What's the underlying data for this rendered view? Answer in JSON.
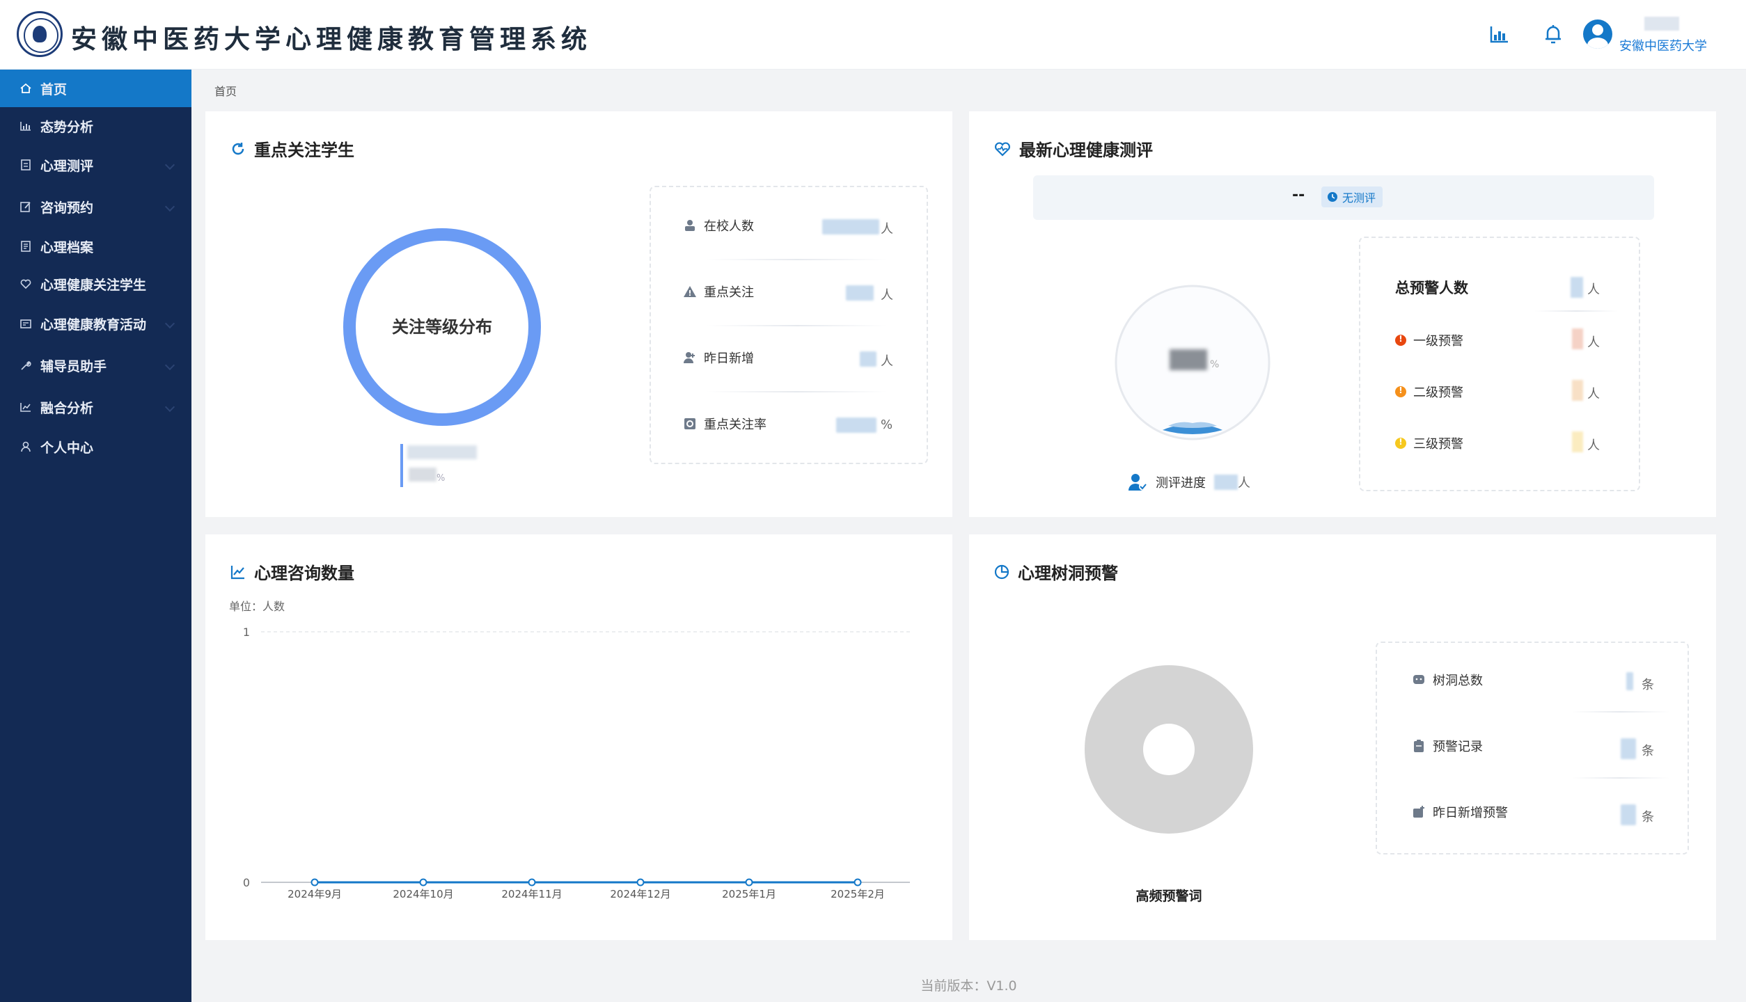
{
  "header": {
    "title": "安徽中医药大学心理健康教育管理系统",
    "user_org": "安徽中医药大学",
    "icons": [
      "chart-icon",
      "bell-icon",
      "user-avatar-icon"
    ]
  },
  "sidebar": {
    "items": [
      {
        "label": "首页",
        "icon": "home-icon",
        "active": true,
        "has_children": false
      },
      {
        "label": "态势分析",
        "icon": "chart-icon",
        "active": false,
        "has_children": false
      },
      {
        "label": "心理测评",
        "icon": "document-icon",
        "active": false,
        "has_children": true
      },
      {
        "label": "咨询预约",
        "icon": "edit-icon",
        "active": false,
        "has_children": true
      },
      {
        "label": "心理档案",
        "icon": "file-icon",
        "active": false,
        "has_children": false
      },
      {
        "label": "心理健康关注学生",
        "icon": "heart-icon",
        "active": false,
        "has_children": false
      },
      {
        "label": "心理健康教育活动",
        "icon": "calendar-icon",
        "active": false,
        "has_children": true
      },
      {
        "label": "辅导员助手",
        "icon": "wrench-icon",
        "active": false,
        "has_children": true
      },
      {
        "label": "融合分析",
        "icon": "analysis-icon",
        "active": false,
        "has_children": true
      },
      {
        "label": "个人中心",
        "icon": "user-icon",
        "active": false,
        "has_children": false
      }
    ]
  },
  "breadcrumb": "首页",
  "focus_students": {
    "title": "重点关注学生",
    "ring_label": "关注等级分布",
    "legend_unit": "%",
    "stats": [
      {
        "label": "在校人数",
        "unit": "人",
        "icon": "students-icon"
      },
      {
        "label": "重点关注",
        "unit": "人",
        "icon": "warning-triangle-icon"
      },
      {
        "label": "昨日新增",
        "unit": "人",
        "icon": "user-add-icon"
      },
      {
        "label": "重点关注率",
        "unit": "%",
        "icon": "rate-icon"
      }
    ]
  },
  "latest_eval": {
    "title": "最新心理健康测评",
    "eval_name": "--",
    "badge": "无测评",
    "gauge_unit": "%",
    "progress_label": "测评进度",
    "progress_unit": "人",
    "warning_total_label": "总预警人数",
    "warning_total_unit": "人",
    "warnings": [
      {
        "label": "一级预警",
        "unit": "人",
        "color": "#e8470f"
      },
      {
        "label": "二级预警",
        "unit": "人",
        "color": "#f5901b"
      },
      {
        "label": "三级预警",
        "unit": "人",
        "color": "#f6c81e"
      }
    ]
  },
  "consult": {
    "title": "心理咨询数量",
    "unit_label": "单位：人数"
  },
  "treehole": {
    "title": "心理树洞预警",
    "donut_label": "高频预警词",
    "stats": [
      {
        "label": "树洞总数",
        "unit": "条",
        "icon": "chat-icon"
      },
      {
        "label": "预警记录",
        "unit": "条",
        "icon": "clipboard-icon"
      },
      {
        "label": "昨日新增预警",
        "unit": "条",
        "icon": "new-warning-icon"
      }
    ]
  },
  "chart_data": {
    "type": "line",
    "title": "心理咨询数量",
    "ylabel": "单位：人数",
    "categories": [
      "2024年9月",
      "2024年10月",
      "2024年11月",
      "2024年12月",
      "2025年1月",
      "2025年2月"
    ],
    "series": [
      {
        "values": [
          0,
          0,
          0,
          0,
          0,
          0
        ]
      }
    ],
    "ylim": [
      0,
      1
    ],
    "yticks": [
      0,
      1
    ],
    "color": "#1478c8",
    "grid": true
  },
  "footer": {
    "version": "当前版本：V1.0"
  }
}
